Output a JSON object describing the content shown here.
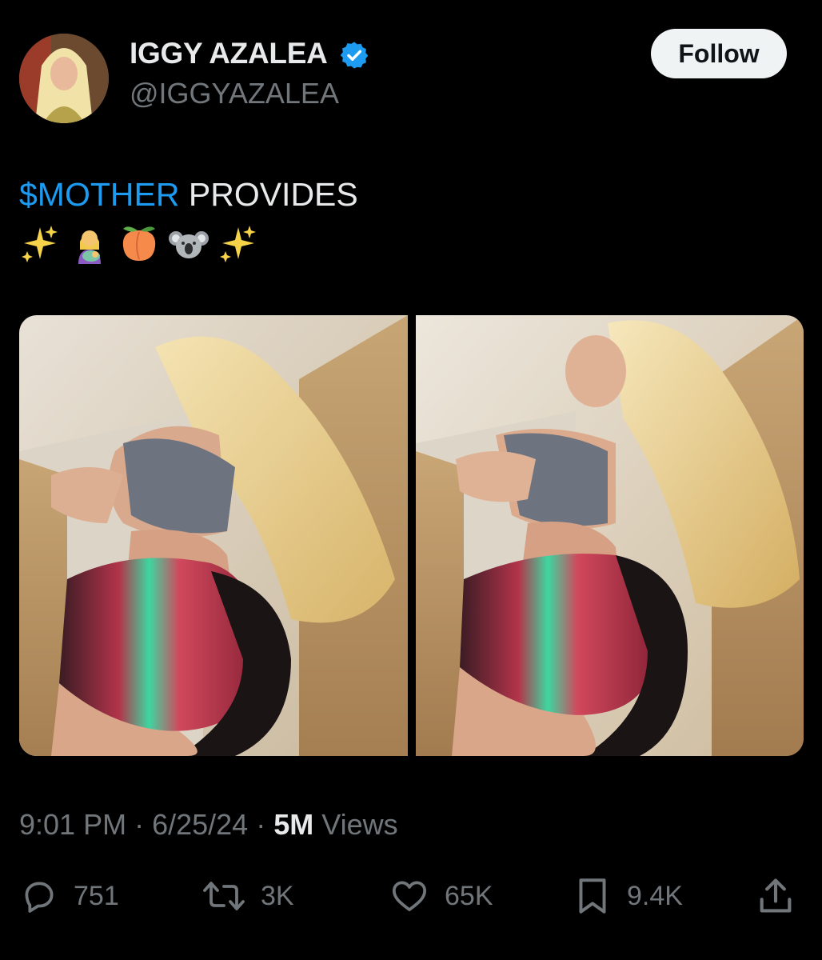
{
  "author": {
    "display_name": "IGGY AZALEA",
    "handle": "@IGGYAZALEA",
    "verified_icon": "verified-badge-icon",
    "verified_color": "#1d9bf0"
  },
  "follow_button": {
    "label": "Follow"
  },
  "tweet": {
    "cashtag": "$MOTHER",
    "text": " PROVIDES",
    "emojis": [
      "sparkles-icon",
      "woman-feeding-baby-icon",
      "peach-icon",
      "koala-icon",
      "sparkles-icon"
    ]
  },
  "media": {
    "count": 2
  },
  "meta": {
    "time": "9:01 PM",
    "separator": " · ",
    "date": "6/25/24",
    "views_count": "5M",
    "views_label": " Views"
  },
  "actions": {
    "replies": "751",
    "reposts": "3K",
    "likes": "65K",
    "bookmarks": "9.4K"
  },
  "colors": {
    "background": "#000000",
    "text_primary": "#e7e9ea",
    "text_secondary": "#71767b",
    "accent": "#1d9bf0",
    "button_bg": "#eff3f4"
  }
}
